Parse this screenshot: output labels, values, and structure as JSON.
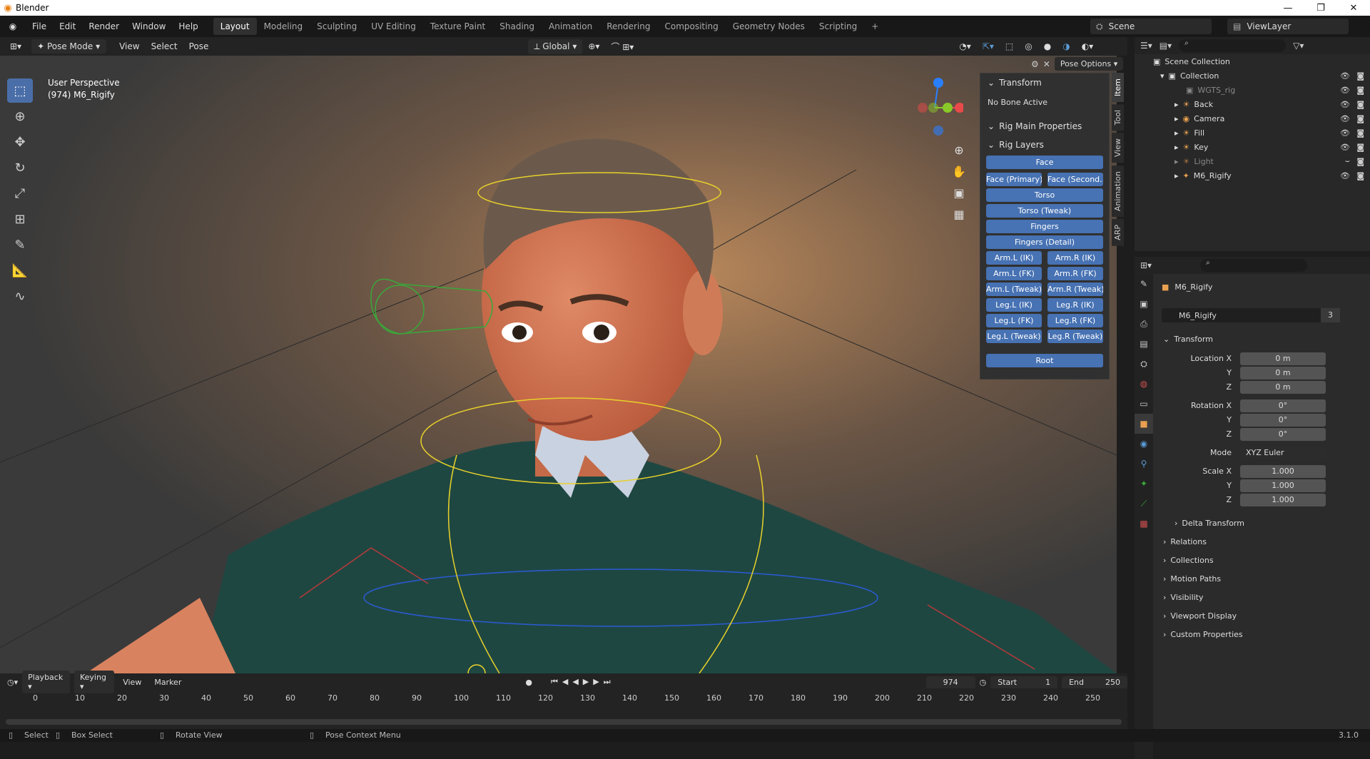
{
  "window": {
    "title": "Blender",
    "min": "—",
    "max": "❐",
    "close": "✕"
  },
  "menu": [
    "File",
    "Edit",
    "Render",
    "Window",
    "Help"
  ],
  "workspaces": [
    "Layout",
    "Modeling",
    "Sculpting",
    "UV Editing",
    "Texture Paint",
    "Shading",
    "Animation",
    "Rendering",
    "Compositing",
    "Geometry Nodes",
    "Scripting",
    "+"
  ],
  "scene": "Scene",
  "view_layer": "ViewLayer",
  "viewport_header": {
    "mode": "Pose Mode",
    "view": "View",
    "select": "Select",
    "pose": "Pose",
    "orientation": "Global",
    "pose_options": "Pose Options"
  },
  "viewport": {
    "perspective": "User Perspective",
    "object": "(974) M6_Rigify"
  },
  "npanel": {
    "transform": "Transform",
    "no_bone": "No Bone Active",
    "rig_main": "Rig Main Properties",
    "rig_layers": "Rig Layers",
    "layers": {
      "face": "Face",
      "face_primary": "Face (Primary)",
      "face_secondary": "Face (Second...",
      "torso": "Torso",
      "torso_tweak": "Torso (Tweak)",
      "fingers": "Fingers",
      "fingers_detail": "Fingers (Detail)",
      "arm_l_ik": "Arm.L (IK)",
      "arm_r_ik": "Arm.R (IK)",
      "arm_l_fk": "Arm.L (FK)",
      "arm_r_fk": "Arm.R (FK)",
      "arm_l_tweak": "Arm.L (Tweak)",
      "arm_r_tweak": "Arm.R (Tweak)",
      "leg_l_ik": "Leg.L (IK)",
      "leg_r_ik": "Leg.R (IK)",
      "leg_l_fk": "Leg.L (FK)",
      "leg_r_fk": "Leg.R (FK)",
      "leg_l_tweak": "Leg.L (Tweak)",
      "leg_r_tweak": "Leg.R (Tweak)",
      "root": "Root"
    },
    "tabs": [
      "Item",
      "Tool",
      "View",
      "Animation",
      "ARP"
    ]
  },
  "outliner": {
    "scene_collection": "Scene Collection",
    "collection": "Collection",
    "items": [
      "WGTS_rig",
      "Back",
      "Camera",
      "Fill",
      "Key",
      "Light",
      "M6_Rigify"
    ]
  },
  "properties": {
    "object_name": "M6_Rigify",
    "datablock": "M6_Rigify",
    "users": "3",
    "transform": "Transform",
    "location_x": "Location X",
    "loc_x": "0 m",
    "y": "Y",
    "loc_y": "0 m",
    "z": "Z",
    "loc_z": "0 m",
    "rotation_x": "Rotation X",
    "rot_x": "0°",
    "rot_y": "0°",
    "rot_z": "0°",
    "mode": "Mode",
    "mode_value": "XYZ Euler",
    "scale_x": "Scale X",
    "sc_x": "1.000",
    "sc_y": "1.000",
    "sc_z": "1.000",
    "sections": [
      "Delta Transform",
      "Relations",
      "Collections",
      "Motion Paths",
      "Visibility",
      "Viewport Display",
      "Custom Properties"
    ]
  },
  "timeline": {
    "playback": "Playback",
    "keying": "Keying",
    "view": "View",
    "marker": "Marker",
    "frame": "974",
    "start_label": "Start",
    "start": "1",
    "end_label": "End",
    "end": "250",
    "ticks": [
      "0",
      "10",
      "20",
      "30",
      "40",
      "50",
      "60",
      "70",
      "80",
      "90",
      "100",
      "110",
      "120",
      "130",
      "140",
      "150",
      "160",
      "170",
      "180",
      "190",
      "200",
      "210",
      "220",
      "230",
      "240",
      "250"
    ]
  },
  "status": {
    "select": "Select",
    "box_select": "Box Select",
    "rotate": "Rotate View",
    "context": "Pose Context Menu",
    "version": "3.1.0"
  }
}
